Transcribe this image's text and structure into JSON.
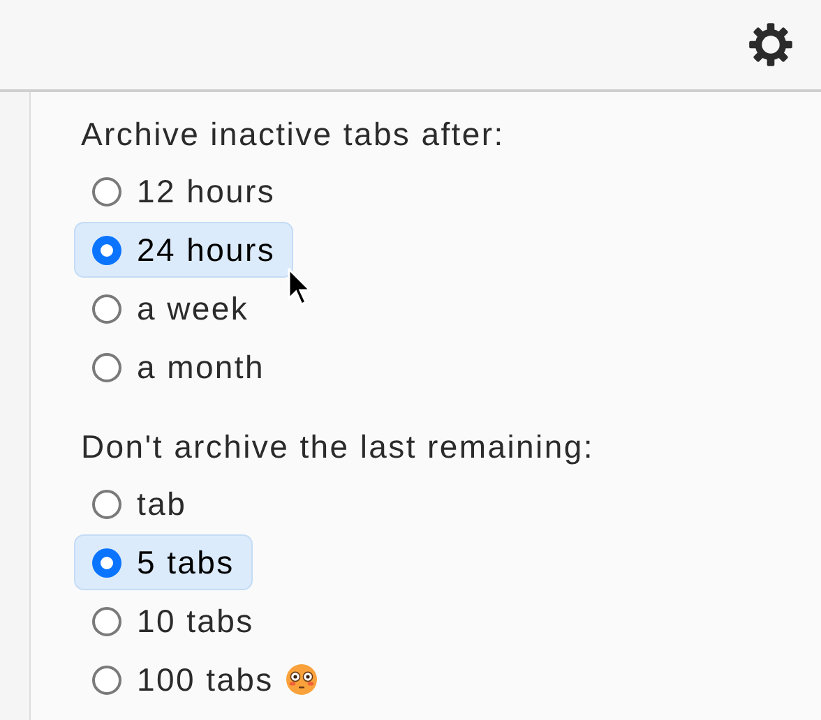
{
  "groups": [
    {
      "heading": "Archive inactive tabs after:",
      "options": [
        {
          "label": "12 hours",
          "selected": false,
          "has_emoji": false
        },
        {
          "label": "24 hours",
          "selected": true,
          "has_emoji": false
        },
        {
          "label": "a week",
          "selected": false,
          "has_emoji": false
        },
        {
          "label": "a month",
          "selected": false,
          "has_emoji": false
        }
      ]
    },
    {
      "heading": "Don't archive the last remaining:",
      "options": [
        {
          "label": "tab",
          "selected": false,
          "has_emoji": false
        },
        {
          "label": "5 tabs",
          "selected": true,
          "has_emoji": false
        },
        {
          "label": "10 tabs",
          "selected": false,
          "has_emoji": false
        },
        {
          "label": "100 tabs",
          "selected": false,
          "has_emoji": true
        }
      ]
    }
  ]
}
